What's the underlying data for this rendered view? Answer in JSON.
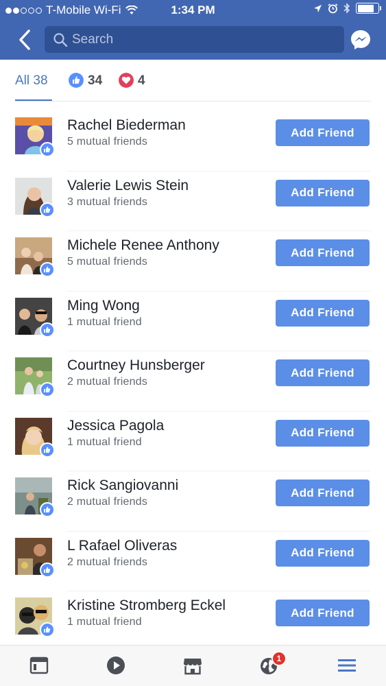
{
  "status_bar": {
    "carrier": "T-Mobile Wi-Fi",
    "time": "1:34 PM",
    "signal_bars_filled": 2,
    "signal_bars_total": 5,
    "battery_level": 0.8
  },
  "header": {
    "back_icon": "chevron-left-icon",
    "search_placeholder": "Search",
    "messenger_icon": "messenger-icon",
    "background": "#4267b2"
  },
  "tabs": {
    "all_label": "All 38",
    "like_count": "34",
    "love_count": "4",
    "active": "all"
  },
  "people": [
    {
      "name": "Rachel Biederman",
      "mutual": "5 mutual friends",
      "button": "Add Friend"
    },
    {
      "name": "Valerie Lewis Stein",
      "mutual": "3 mutual friends",
      "button": "Add Friend"
    },
    {
      "name": "Michele Renee Anthony",
      "mutual": "5 mutual friends",
      "button": "Add Friend"
    },
    {
      "name": "Ming Wong",
      "mutual": "1 mutual friend",
      "button": "Add Friend"
    },
    {
      "name": "Courtney Hunsberger",
      "mutual": "2 mutual friends",
      "button": "Add Friend"
    },
    {
      "name": "Jessica Pagola",
      "mutual": "1 mutual friend",
      "button": "Add Friend"
    },
    {
      "name": "Rick Sangiovanni",
      "mutual": "2 mutual friends",
      "button": "Add Friend"
    },
    {
      "name": "L Rafael Oliveras",
      "mutual": "2 mutual friends",
      "button": "Add Friend"
    },
    {
      "name": "Kristine Stromberg Eckel",
      "mutual": "1 mutual friend",
      "button": "Add Friend"
    }
  ],
  "tab_bar": {
    "items": [
      "news-feed-icon",
      "video-icon",
      "marketplace-icon",
      "notifications-icon",
      "menu-icon"
    ],
    "notification_badge": "1"
  },
  "colors": {
    "accent": "#4a76c4",
    "button": "#5b8ee6",
    "like": "#5890ff",
    "love": "#e2405a"
  }
}
